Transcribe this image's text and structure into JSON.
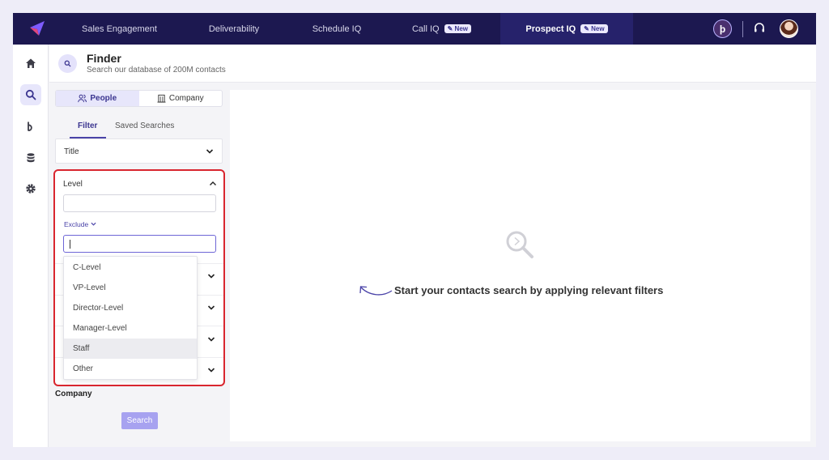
{
  "nav": {
    "items": [
      {
        "label": "Sales Engagement",
        "badge": null,
        "active": false
      },
      {
        "label": "Deliverability",
        "badge": null,
        "active": false
      },
      {
        "label": "Schedule IQ",
        "badge": null,
        "active": false
      },
      {
        "label": "Call IQ",
        "badge": "New",
        "active": false
      },
      {
        "label": "Prospect IQ",
        "badge": "New",
        "active": true
      }
    ],
    "brand_avatar_letter": "þ",
    "icons": [
      "logo-icon",
      "headset-icon",
      "user-avatar"
    ]
  },
  "sidebar": {
    "items": [
      {
        "icon": "home-icon",
        "active": false
      },
      {
        "icon": "search-icon",
        "active": true
      },
      {
        "icon": "brand-icon",
        "active": false
      },
      {
        "icon": "database-icon",
        "active": false
      },
      {
        "icon": "gear-icon",
        "active": false
      }
    ]
  },
  "header": {
    "title": "Finder",
    "subtitle": "Search our database of 200M contacts"
  },
  "toggle": {
    "people": "People",
    "company": "Company",
    "selected": "People"
  },
  "subtabs": {
    "filter": "Filter",
    "saved": "Saved Searches",
    "selected": "Filter"
  },
  "filters": {
    "title_label": "Title",
    "level_label": "Level",
    "exclude_label": "Exclude",
    "level_input_value": "",
    "exclude_input_value": "",
    "company_label": "Company"
  },
  "dropdown": {
    "options": [
      "C-Level",
      "VP-Level",
      "Director-Level",
      "Manager-Level",
      "Staff",
      "Other"
    ],
    "hovered": "Staff"
  },
  "search_button": "Search",
  "empty_state": {
    "message": "Start your contacts search by applying relevant filters"
  },
  "colors": {
    "nav_bg": "#1c1850",
    "accent": "#4a43a8",
    "highlight_border": "#d9262f",
    "search_button": "#a7a2f0"
  }
}
